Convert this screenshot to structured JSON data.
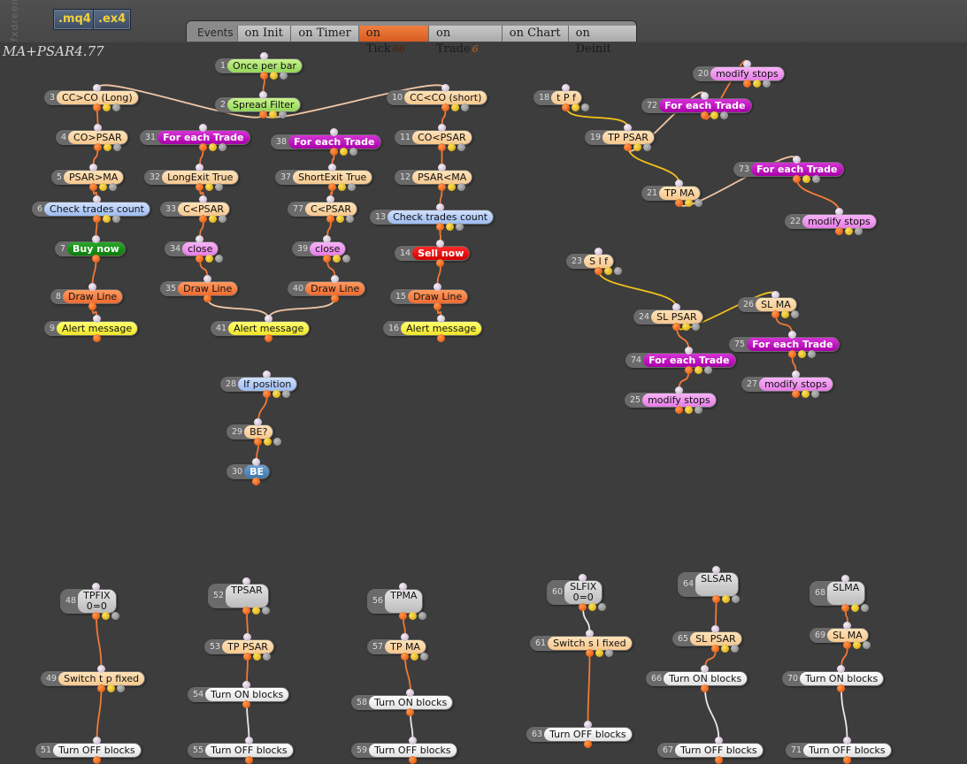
{
  "app": {
    "side_label": "fxdreema",
    "file_buttons": [
      ".mq4",
      ".ex4"
    ],
    "project_title": "MA+PSAR4.77"
  },
  "events_bar": {
    "label": "Events",
    "tabs": [
      {
        "label": "on Init",
        "count": ""
      },
      {
        "label": "on Timer",
        "count": ""
      },
      {
        "label": "on Tick",
        "count": "66",
        "active": true
      },
      {
        "label": "on Trade",
        "count": "6"
      },
      {
        "label": "on Chart",
        "count": ""
      },
      {
        "label": "on Deinit",
        "count": ""
      }
    ]
  },
  "blocks": [
    {
      "id": "1",
      "label": "Once per bar",
      "color": "green"
    },
    {
      "id": "2",
      "label": "Spread Filter",
      "color": "green"
    },
    {
      "id": "3",
      "label": "CC>CO (Long)",
      "color": "beige"
    },
    {
      "id": "4",
      "label": "CO>PSAR",
      "color": "beige"
    },
    {
      "id": "5",
      "label": "PSAR>MA",
      "color": "beige"
    },
    {
      "id": "6",
      "label": "Check trades count",
      "color": "blue"
    },
    {
      "id": "7",
      "label": "Buy now",
      "color": "buy"
    },
    {
      "id": "8",
      "label": "Draw Line",
      "color": "orange"
    },
    {
      "id": "9",
      "label": "Alert message",
      "color": "yellow"
    },
    {
      "id": "10",
      "label": "CC<CO (short)",
      "color": "beige"
    },
    {
      "id": "11",
      "label": "CO<PSAR",
      "color": "beige"
    },
    {
      "id": "12",
      "label": "PSAR<MA",
      "color": "beige"
    },
    {
      "id": "13",
      "label": "Check trades count",
      "color": "blue"
    },
    {
      "id": "14",
      "label": "Sell now",
      "color": "sell"
    },
    {
      "id": "15",
      "label": "Draw Line",
      "color": "orange"
    },
    {
      "id": "16",
      "label": "Alert message",
      "color": "yellow"
    },
    {
      "id": "31",
      "label": "For each Trade",
      "color": "magenta"
    },
    {
      "id": "32",
      "label": "LongExit True",
      "color": "beige"
    },
    {
      "id": "33",
      "label": "C<PSAR",
      "color": "beige"
    },
    {
      "id": "34",
      "label": "close",
      "color": "pink"
    },
    {
      "id": "35",
      "label": "Draw Line",
      "color": "orange"
    },
    {
      "id": "38",
      "label": "For each Trade",
      "color": "magenta"
    },
    {
      "id": "37",
      "label": "ShortExit True",
      "color": "beige"
    },
    {
      "id": "77",
      "label": "C<PSAR",
      "color": "beige"
    },
    {
      "id": "39",
      "label": "close",
      "color": "pink"
    },
    {
      "id": "40",
      "label": "Draw Line",
      "color": "orange"
    },
    {
      "id": "41",
      "label": "Alert message",
      "color": "yellow"
    },
    {
      "id": "28",
      "label": "If position",
      "color": "blue"
    },
    {
      "id": "29",
      "label": "BE?",
      "color": "beige"
    },
    {
      "id": "30",
      "label": "BE",
      "color": "steel"
    },
    {
      "id": "18",
      "label": "t P f",
      "color": "beige"
    },
    {
      "id": "19",
      "label": "TP PSAR",
      "color": "beige"
    },
    {
      "id": "20",
      "label": "modify stops",
      "color": "pink"
    },
    {
      "id": "72",
      "label": "For each Trade",
      "color": "magenta"
    },
    {
      "id": "21",
      "label": "TP MA",
      "color": "beige"
    },
    {
      "id": "73",
      "label": "For each Trade",
      "color": "magenta"
    },
    {
      "id": "22",
      "label": "modify stops",
      "color": "pink"
    },
    {
      "id": "23",
      "label": "S l f",
      "color": "beige"
    },
    {
      "id": "24",
      "label": "SL PSAR",
      "color": "beige"
    },
    {
      "id": "26",
      "label": "SL MA",
      "color": "beige"
    },
    {
      "id": "75",
      "label": "For each Trade",
      "color": "magenta"
    },
    {
      "id": "74",
      "label": "For each Trade",
      "color": "magenta"
    },
    {
      "id": "27",
      "label": "modify stops",
      "color": "pink"
    },
    {
      "id": "25",
      "label": "modify stops",
      "color": "pink"
    },
    {
      "id": "48",
      "label": "TPFIX\n0=0",
      "color": "gray"
    },
    {
      "id": "49",
      "label": "Switch t p fixed",
      "color": "beige"
    },
    {
      "id": "51",
      "label": "Turn OFF blocks",
      "color": "white"
    },
    {
      "id": "52",
      "label": "TPSAR",
      "color": "gray"
    },
    {
      "id": "53",
      "label": "TP PSAR",
      "color": "beige"
    },
    {
      "id": "54",
      "label": "Turn ON blocks",
      "color": "white"
    },
    {
      "id": "55",
      "label": "Turn OFF blocks",
      "color": "white"
    },
    {
      "id": "56",
      "label": "TPMA",
      "color": "gray"
    },
    {
      "id": "57",
      "label": "TP MA",
      "color": "beige"
    },
    {
      "id": "58",
      "label": "Turn ON blocks",
      "color": "white"
    },
    {
      "id": "59",
      "label": "Turn OFF blocks",
      "color": "white"
    },
    {
      "id": "60",
      "label": "SLFIX\n0=0",
      "color": "gray"
    },
    {
      "id": "61",
      "label": "Switch s l fixed",
      "color": "beige"
    },
    {
      "id": "63",
      "label": "Turn OFF blocks",
      "color": "white"
    },
    {
      "id": "64",
      "label": "SLSAR",
      "color": "gray"
    },
    {
      "id": "65",
      "label": "SL PSAR",
      "color": "beige"
    },
    {
      "id": "66",
      "label": "Turn ON blocks",
      "color": "white"
    },
    {
      "id": "67",
      "label": "Turn OFF blocks",
      "color": "white"
    },
    {
      "id": "68",
      "label": "SLMA",
      "color": "gray"
    },
    {
      "id": "69",
      "label": "SL MA",
      "color": "beige"
    },
    {
      "id": "70",
      "label": "Turn ON blocks",
      "color": "white"
    },
    {
      "id": "71",
      "label": "Turn OFF blocks",
      "color": "white"
    }
  ],
  "connections": [
    [
      "1",
      "2",
      "orange"
    ],
    [
      "2",
      "3",
      "beige"
    ],
    [
      "2",
      "10",
      "beige"
    ],
    [
      "3",
      "4",
      "orange"
    ],
    [
      "4",
      "5",
      "orange"
    ],
    [
      "5",
      "6",
      "orange"
    ],
    [
      "6",
      "7",
      "orange"
    ],
    [
      "7",
      "8",
      "orange"
    ],
    [
      "8",
      "9",
      "orange"
    ],
    [
      "10",
      "11",
      "orange"
    ],
    [
      "11",
      "12",
      "orange"
    ],
    [
      "12",
      "13",
      "orange"
    ],
    [
      "13",
      "14",
      "orange"
    ],
    [
      "14",
      "15",
      "orange"
    ],
    [
      "15",
      "16",
      "orange"
    ],
    [
      "31",
      "32",
      "orange"
    ],
    [
      "32",
      "33",
      "orange"
    ],
    [
      "33",
      "34",
      "orange"
    ],
    [
      "34",
      "35",
      "orange"
    ],
    [
      "35",
      "41",
      "beige"
    ],
    [
      "38",
      "37",
      "orange"
    ],
    [
      "37",
      "77",
      "orange"
    ],
    [
      "77",
      "39",
      "orange"
    ],
    [
      "39",
      "40",
      "orange"
    ],
    [
      "40",
      "41",
      "beige"
    ],
    [
      "28",
      "29",
      "orange"
    ],
    [
      "29",
      "30",
      "orange"
    ],
    [
      "18",
      "19",
      "yellow"
    ],
    [
      "19",
      "72",
      "beige"
    ],
    [
      "72",
      "20",
      "orange"
    ],
    [
      "19",
      "21",
      "yellow"
    ],
    [
      "21",
      "73",
      "beige"
    ],
    [
      "73",
      "22",
      "orange"
    ],
    [
      "23",
      "24",
      "yellow"
    ],
    [
      "24",
      "26",
      "yellow"
    ],
    [
      "24",
      "74",
      "orange"
    ],
    [
      "74",
      "25",
      "orange"
    ],
    [
      "26",
      "75",
      "orange"
    ],
    [
      "75",
      "27",
      "orange"
    ],
    [
      "48",
      "49",
      "orange"
    ],
    [
      "49",
      "51",
      "orange"
    ],
    [
      "52",
      "53",
      "orange"
    ],
    [
      "53",
      "54",
      "orange"
    ],
    [
      "54",
      "55",
      "white"
    ],
    [
      "56",
      "57",
      "orange"
    ],
    [
      "57",
      "58",
      "orange"
    ],
    [
      "58",
      "59",
      "white"
    ],
    [
      "60",
      "61",
      "white"
    ],
    [
      "61",
      "63",
      "orange"
    ],
    [
      "64",
      "65",
      "orange"
    ],
    [
      "65",
      "66",
      "orange"
    ],
    [
      "66",
      "67",
      "white"
    ],
    [
      "68",
      "69",
      "orange"
    ],
    [
      "69",
      "70",
      "orange"
    ],
    [
      "70",
      "71",
      "white"
    ]
  ]
}
